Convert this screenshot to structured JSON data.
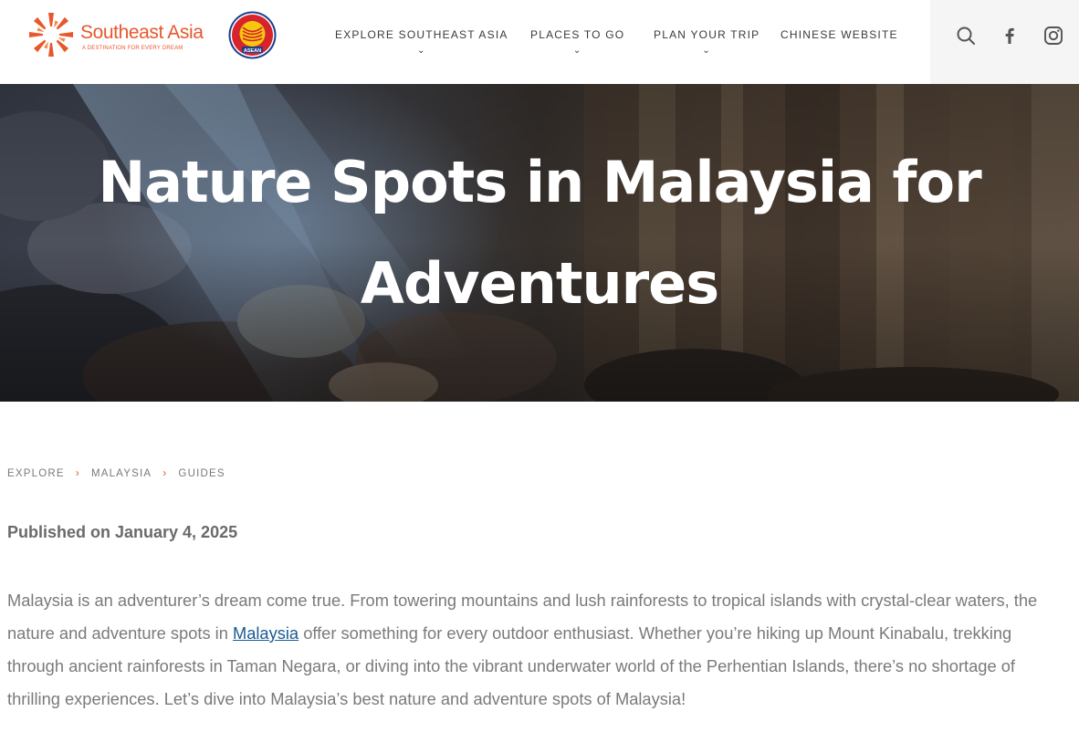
{
  "brand": {
    "name": "Southeast Asia",
    "tagline": "A DESTINATION FOR EVERY DREAM",
    "logo_color": "#e8572c",
    "asean_badge_text": "ASEAN"
  },
  "nav": {
    "items": [
      {
        "label": "EXPLORE SOUTHEAST ASIA",
        "has_dropdown": true,
        "chevron": "⌄"
      },
      {
        "label": "PLACES TO GO",
        "has_dropdown": true,
        "chevron": "⌄"
      },
      {
        "label": "PLAN YOUR TRIP",
        "has_dropdown": true,
        "chevron": "⌄"
      },
      {
        "label": "CHINESE WEBSITE",
        "has_dropdown": false,
        "chevron": ""
      }
    ]
  },
  "social": {
    "icons": [
      "search-icon",
      "facebook-icon",
      "instagram-icon"
    ]
  },
  "hero": {
    "title_line1": "Nature Spots in Malaysia for",
    "title_line2": "Adventures"
  },
  "breadcrumb": {
    "items": [
      "EXPLORE",
      "MALAYSIA",
      "GUIDES"
    ],
    "separator": "›",
    "separator_color": "#e8572c"
  },
  "article": {
    "published": "Published on January 4, 2025",
    "intro_before_link": "Malaysia is an adventurer’s dream come true. From towering mountains and lush rainforests to tropical islands with crystal-clear waters, the nature and adventure spots in ",
    "intro_link": "Malaysia",
    "intro_after_link": " offer something for every outdoor enthusiast. Whether you’re hiking up Mount Kinabalu, trekking through ancient rainforests in Taman Negara, or diving into the vibrant underwater world of the Perhentian Islands, there’s no shortage of thrilling experiences. Let’s dive into Malaysia’s best nature and adventure spots of Malaysia!",
    "link_color": "#1a5a92"
  }
}
